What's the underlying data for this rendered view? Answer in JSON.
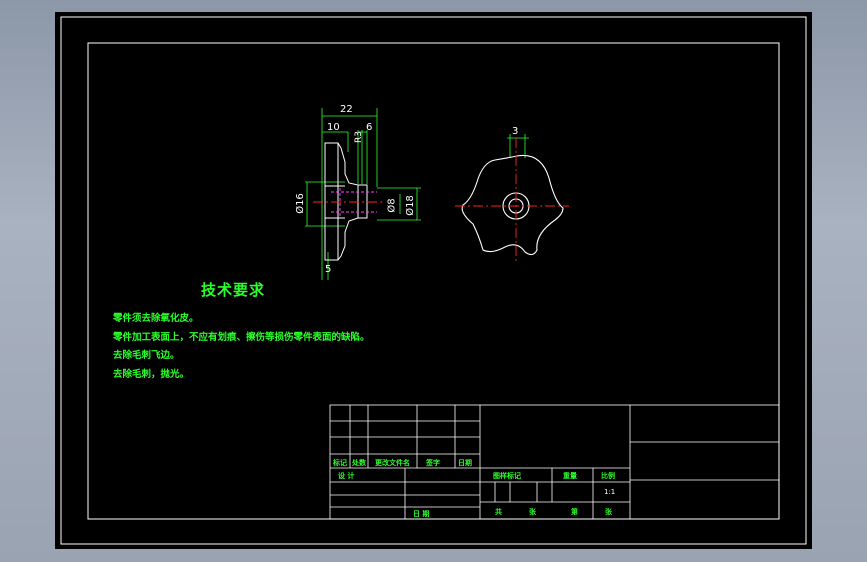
{
  "colors": {
    "background": "#000000",
    "frame": "#ffffff",
    "green": "#2bff2b",
    "red_centerline": "#ff2020",
    "magenta_hidden": "#ff40ff",
    "cyan": "#40e0ff"
  },
  "drawing": {
    "section_view": {
      "dim_overall_width": "22",
      "dim_flange": "10",
      "dim_right": "6",
      "dim_small": "R3",
      "dim_hub_dia": "Ø16",
      "dim_bore": "Ø8",
      "dim_outer_dia": "Ø18",
      "dim_bottom": "5"
    },
    "top_view": {
      "dim_top": "3"
    }
  },
  "technical_requirements": {
    "title": "技术要求",
    "notes": [
      "零件须去除氧化皮。",
      "零件加工表面上，不应有划痕、擦伤等损伤零件表面的缺陷。",
      "去除毛刺飞边。",
      "去除毛刺，抛光。"
    ]
  },
  "title_block": {
    "revision_headers": [
      "标记",
      "处数",
      "更改文件名",
      "签字",
      "日期"
    ],
    "design_label": "设 计",
    "date_label": "日 期",
    "stage_headers": [
      "图样标记",
      "重量",
      "比例"
    ],
    "scale": "1:1",
    "sheet_total_label": "共",
    "sheet_total_unit": "张",
    "sheet_no_label": "第",
    "sheet_no_unit": "张"
  }
}
